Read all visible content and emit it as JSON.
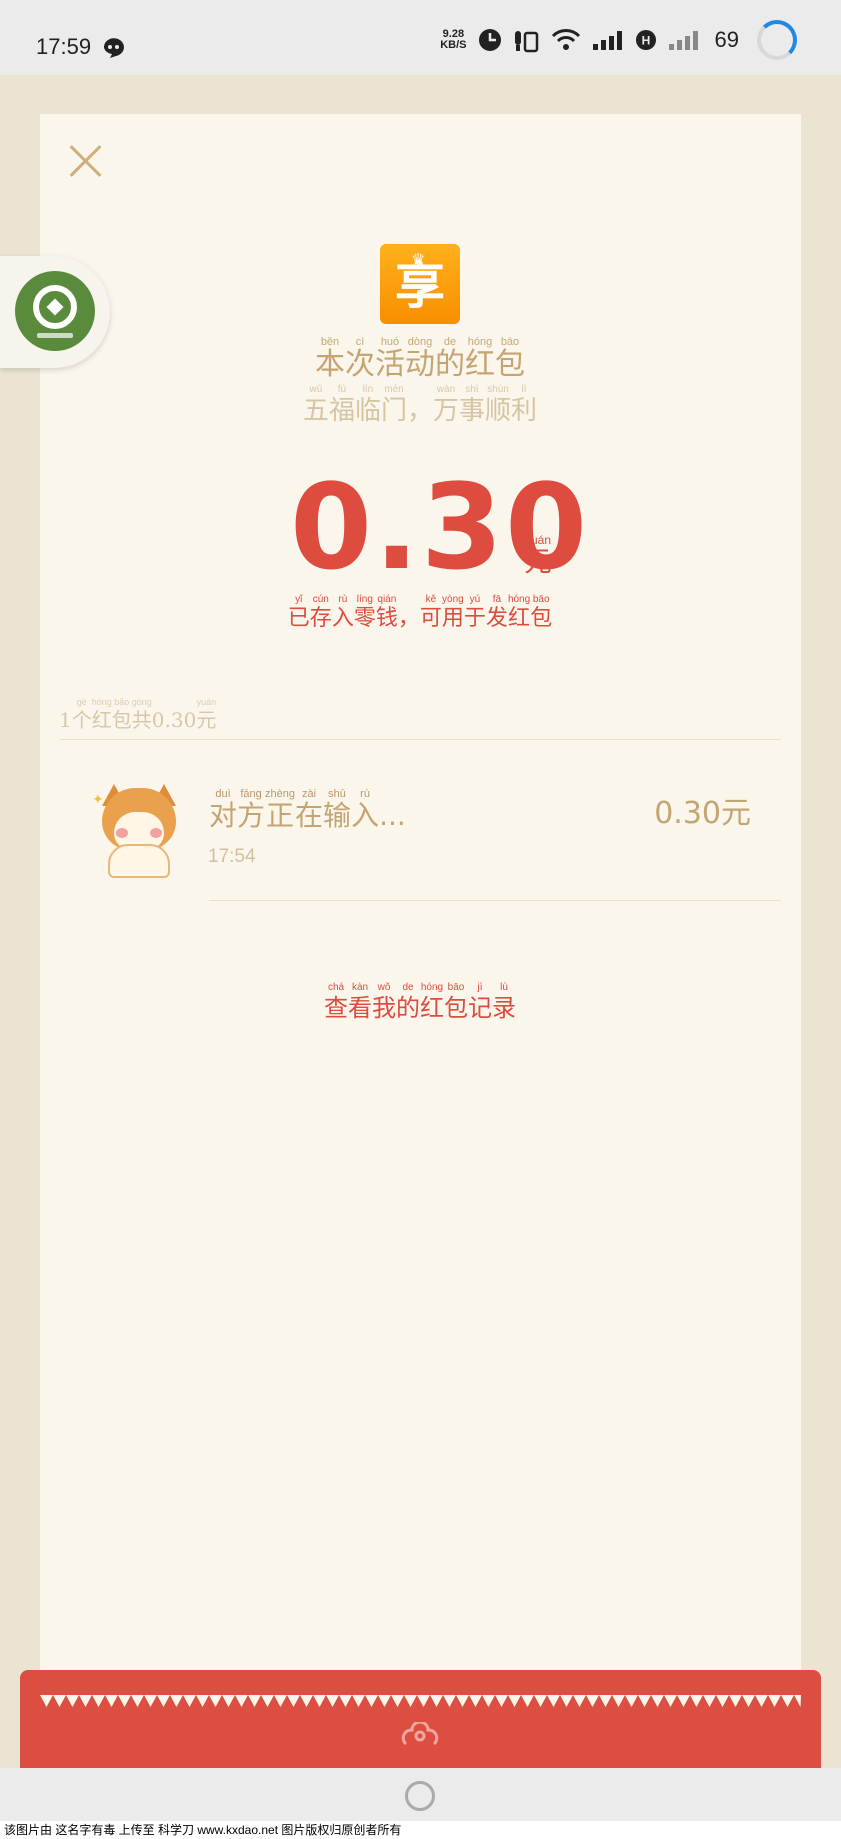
{
  "status_bar": {
    "time": "17:59",
    "speed_value": "9.28",
    "speed_unit": "KB/S",
    "battery": "69",
    "icons": [
      "chat-bubble-icon",
      "clock-icon",
      "vibrate-icon",
      "wifi-icon",
      "signal-icon",
      "hd-icon",
      "signal2-icon"
    ],
    "battery_color": "#1e88e5"
  },
  "header": {
    "close_icon": "close-icon",
    "app_logo_char": "享",
    "app_logo_crown": "♛"
  },
  "title": {
    "chars": [
      {
        "py": "běn",
        "hz": "本"
      },
      {
        "py": "cì",
        "hz": "次"
      },
      {
        "py": "huó",
        "hz": "活"
      },
      {
        "py": "dòng",
        "hz": "动"
      },
      {
        "py": "de",
        "hz": "的"
      },
      {
        "py": "hóng",
        "hz": "红"
      },
      {
        "py": "bāo",
        "hz": "包"
      }
    ]
  },
  "subtitle": {
    "chars": [
      {
        "py": "wǔ",
        "hz": "五"
      },
      {
        "py": "fú",
        "hz": "福"
      },
      {
        "py": "lín",
        "hz": "临"
      },
      {
        "py": "mén",
        "hz": "门"
      },
      {
        "py": "",
        "hz": "，"
      },
      {
        "py": "wàn",
        "hz": "万"
      },
      {
        "py": "shì",
        "hz": "事"
      },
      {
        "py": "shùn",
        "hz": "顺"
      },
      {
        "py": "lì",
        "hz": "利"
      }
    ]
  },
  "amount": {
    "value": "0.30",
    "unit_py": "yuán",
    "unit": "元",
    "color": "#de4b3f"
  },
  "saved_note": {
    "chars": [
      {
        "py": "yǐ",
        "hz": "已"
      },
      {
        "py": "cún",
        "hz": "存"
      },
      {
        "py": "rù",
        "hz": "入"
      },
      {
        "py": "líng",
        "hz": "零"
      },
      {
        "py": "qián",
        "hz": "钱"
      },
      {
        "py": "",
        "hz": "，"
      },
      {
        "py": "kě",
        "hz": "可"
      },
      {
        "py": "yòng",
        "hz": "用"
      },
      {
        "py": "yú",
        "hz": "于"
      },
      {
        "py": "fā",
        "hz": "发"
      },
      {
        "py": "hóng",
        "hz": "红"
      },
      {
        "py": "bāo",
        "hz": "包"
      }
    ]
  },
  "summary": {
    "chars": [
      {
        "py": "",
        "hz": "1"
      },
      {
        "py": "gè",
        "hz": "个"
      },
      {
        "py": "hóng",
        "hz": "红"
      },
      {
        "py": "bāo",
        "hz": "包"
      },
      {
        "py": "gòng",
        "hz": "共"
      },
      {
        "py": "",
        "hz": "0.30"
      },
      {
        "py": "yuán",
        "hz": "元"
      }
    ]
  },
  "record": {
    "avatar_icon": "shiba-dog-avatar",
    "name_chars": [
      {
        "py": "duì",
        "hz": "对"
      },
      {
        "py": "fāng",
        "hz": "方"
      },
      {
        "py": "zhèng",
        "hz": "正"
      },
      {
        "py": "zài",
        "hz": "在"
      },
      {
        "py": "shū",
        "hz": "输"
      },
      {
        "py": "rù",
        "hz": "入"
      }
    ],
    "name_ellipsis": "...",
    "time": "17:54",
    "amount": "0.30元"
  },
  "records_link": {
    "chars": [
      {
        "py": "chá",
        "hz": "查"
      },
      {
        "py": "kàn",
        "hz": "看"
      },
      {
        "py": "wǒ",
        "hz": "我"
      },
      {
        "py": "de",
        "hz": "的"
      },
      {
        "py": "hóng",
        "hz": "红"
      },
      {
        "py": "bāo",
        "hz": "包"
      },
      {
        "py": "jì",
        "hz": "记"
      },
      {
        "py": "lù",
        "hz": "录"
      }
    ]
  },
  "footer": {
    "icon": "cloud-swirl-icon",
    "color": "#dc4e41"
  },
  "nav": {
    "home_icon": "home-circle-icon"
  },
  "watermark": "该图片由 这名字有毒 上传至 科学刀 www.kxdao.net 图片版权归原创者所有"
}
